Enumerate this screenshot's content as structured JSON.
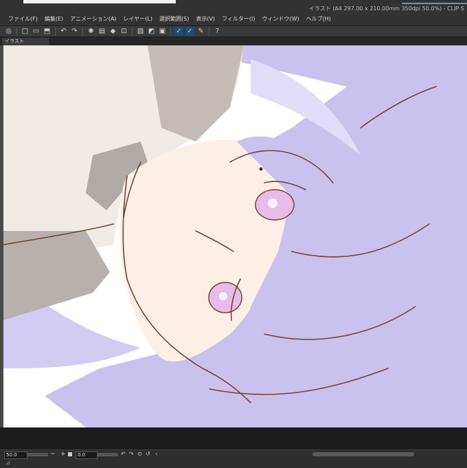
{
  "window": {
    "title": "イラスト (A4 297.00 x 210.00mm 350dpi 50.0%) - CLIP S"
  },
  "menu": [
    "ファイル(F)",
    "編集(E)",
    "アニメーション(A)",
    "レイヤー(L)",
    "選択範囲(S)",
    "表示(V)",
    "フィルター(I)",
    "ウィンドウ(W)",
    "ヘルプ(H)"
  ],
  "toolbar": {
    "icons": [
      "app-icon",
      "new-file-icon",
      "open-icon",
      "save-icon",
      "undo-icon",
      "redo-icon",
      "loading-icon",
      "copy-icon",
      "fill-icon",
      "transform-icon",
      "snap-off-icon",
      "snap-icon",
      "ruler-icon",
      "stroke-correct-icon",
      "stroke-correct-active-icon",
      "pen-settings-icon",
      "help-icon"
    ]
  },
  "tab": {
    "label": "イラスト"
  },
  "status": {
    "zoom": "50.0",
    "angle": "0.0",
    "minus": "−",
    "plus": "+",
    "corner": "⊿"
  },
  "colors": {
    "hair": "#c9c2ee",
    "skin": "#fcf0e6",
    "shirt": "#efe8e3",
    "shadow": "#b9b2ae",
    "eye": "#e6bde9",
    "line": "#7c3f2e"
  }
}
